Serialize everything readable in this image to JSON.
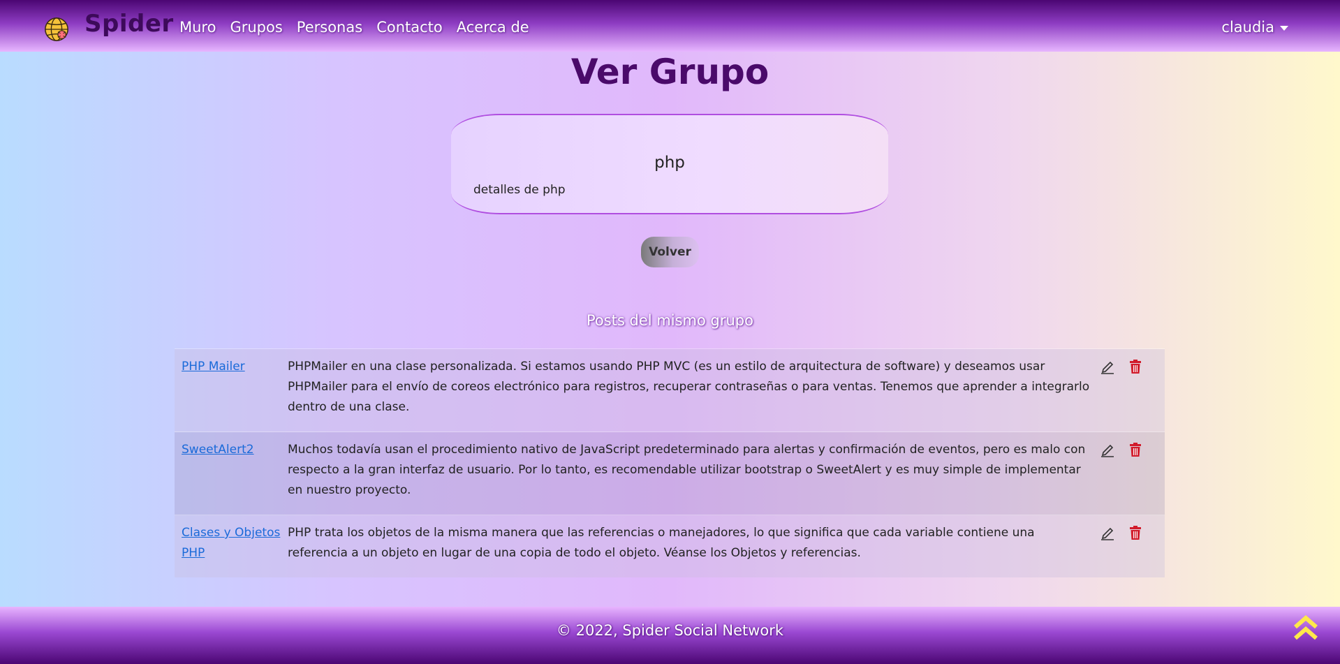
{
  "navbar": {
    "brand": "Spider",
    "links": [
      "Muro",
      "Grupos",
      "Personas",
      "Contacto",
      "Acerca de"
    ],
    "user": "claudia"
  },
  "page": {
    "title": "Ver Grupo"
  },
  "group": {
    "name": "php",
    "details": "detalles de php"
  },
  "back_button": "Volver",
  "posts_section": {
    "title": "Posts del mismo grupo",
    "posts": [
      {
        "title": "PHP Mailer",
        "body": "PHPMailer en una clase personalizada. Si estamos usando PHP MVC (es un estilo de arquitectura de software) y deseamos usar PHPMailer para el envío de coreos electrónico para registros, recuperar contraseñas o para ventas. Tenemos que aprender a integrarlo dentro de una clase."
      },
      {
        "title": "SweetAlert2",
        "body": "Muchos todavía usan el procedimiento nativo de JavaScript predeterminado para alertas y confirmación de eventos, pero es malo con respecto a la gran interfaz de usuario. Por lo tanto, es recomendable utilizar bootstrap o SweetAlert y es muy simple de implementar en nuestro proyecto."
      },
      {
        "title": "Clases y Objetos PHP",
        "body": "PHP trata los objetos de la misma manera que las referencias o manejadores, lo que significa que cada variable contiene una referencia a un objeto en lugar de una copia de todo el objeto. Véanse los Objetos y referencias."
      }
    ]
  },
  "footer": {
    "text": "© 2022, Spider Social Network"
  },
  "icons": {
    "logo": "globe-spider-icon",
    "edit": "pencil-icon",
    "delete": "trash-icon",
    "scroll_top": "double-chevron-up-icon"
  },
  "colors": {
    "nav_dark": "#4b0673",
    "title": "#4a0a6a",
    "link": "#1a6ad9",
    "delete": "#d11a2a",
    "scroll_top": "#ffe94a"
  }
}
